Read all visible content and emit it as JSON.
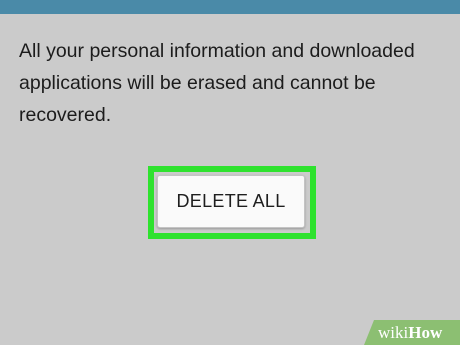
{
  "dialog": {
    "message": "All your personal information and downloaded applications will be erased and cannot be recovered.",
    "delete_all_label": "DELETE ALL"
  },
  "colors": {
    "top_bar": "#4a8aa8",
    "background": "#cbcbcb",
    "highlight": "#2ee22e"
  },
  "watermark": {
    "wiki": "wiki",
    "how": "How"
  }
}
